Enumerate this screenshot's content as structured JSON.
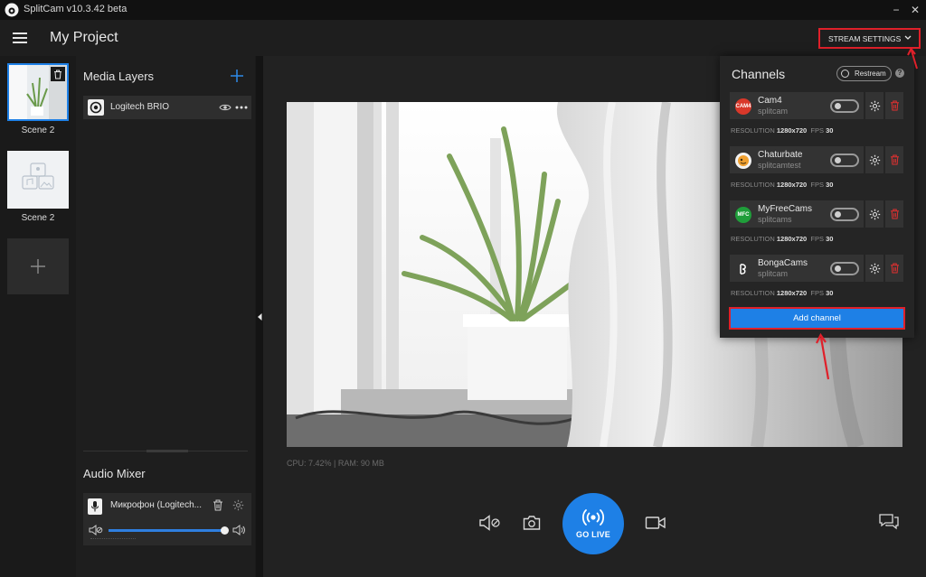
{
  "window": {
    "title": "SplitCam v10.3.42 beta",
    "minimize": "−",
    "close": "✕"
  },
  "header": {
    "project_title": "My Project",
    "stream_settings_label": "STREAM SETTINGS"
  },
  "scenes": [
    {
      "label": "Scene 2"
    },
    {
      "label": "Scene 2"
    }
  ],
  "media_layers": {
    "title": "Media Layers",
    "items": [
      {
        "name": "Logitech BRIO"
      }
    ]
  },
  "audio_mixer": {
    "title": "Audio Mixer",
    "items": [
      {
        "name": "Микрофон (Logitech...",
        "volume": 1.0
      }
    ]
  },
  "stats": {
    "text": "CPU: 7.42% | RAM: 90 MB"
  },
  "controls": {
    "go_live_label": "GO LIVE"
  },
  "channels": {
    "title": "Channels",
    "restream_label": "Restream",
    "help": "?",
    "resolution_label": "RESOLUTION",
    "fps_label": "FPS",
    "items": [
      {
        "name": "Cam4",
        "user": "splitcam",
        "resolution": "1280x720",
        "fps": "30",
        "logo": "cam4-logo",
        "logo_text": "CAM4",
        "color": "#d9382a"
      },
      {
        "name": "Chaturbate",
        "user": "splitcamtest",
        "resolution": "1280x720",
        "fps": "30",
        "logo": "chaturbate-logo",
        "logo_text": "",
        "color": "#f0a030"
      },
      {
        "name": "MyFreeCams",
        "user": "splitcams",
        "resolution": "1280x720",
        "fps": "30",
        "logo": "myfreecams-logo",
        "logo_text": "MFC",
        "color": "#1f9e3a"
      },
      {
        "name": "BongaCams",
        "user": "splitcam",
        "resolution": "1280x720",
        "fps": "30",
        "logo": "bongacams-logo",
        "logo_text": "",
        "color": "#ffffff"
      }
    ],
    "add_channel_label": "Add channel"
  },
  "colors": {
    "accent": "#1e80e6",
    "highlight": "#e0202a",
    "delete": "#e03030"
  }
}
